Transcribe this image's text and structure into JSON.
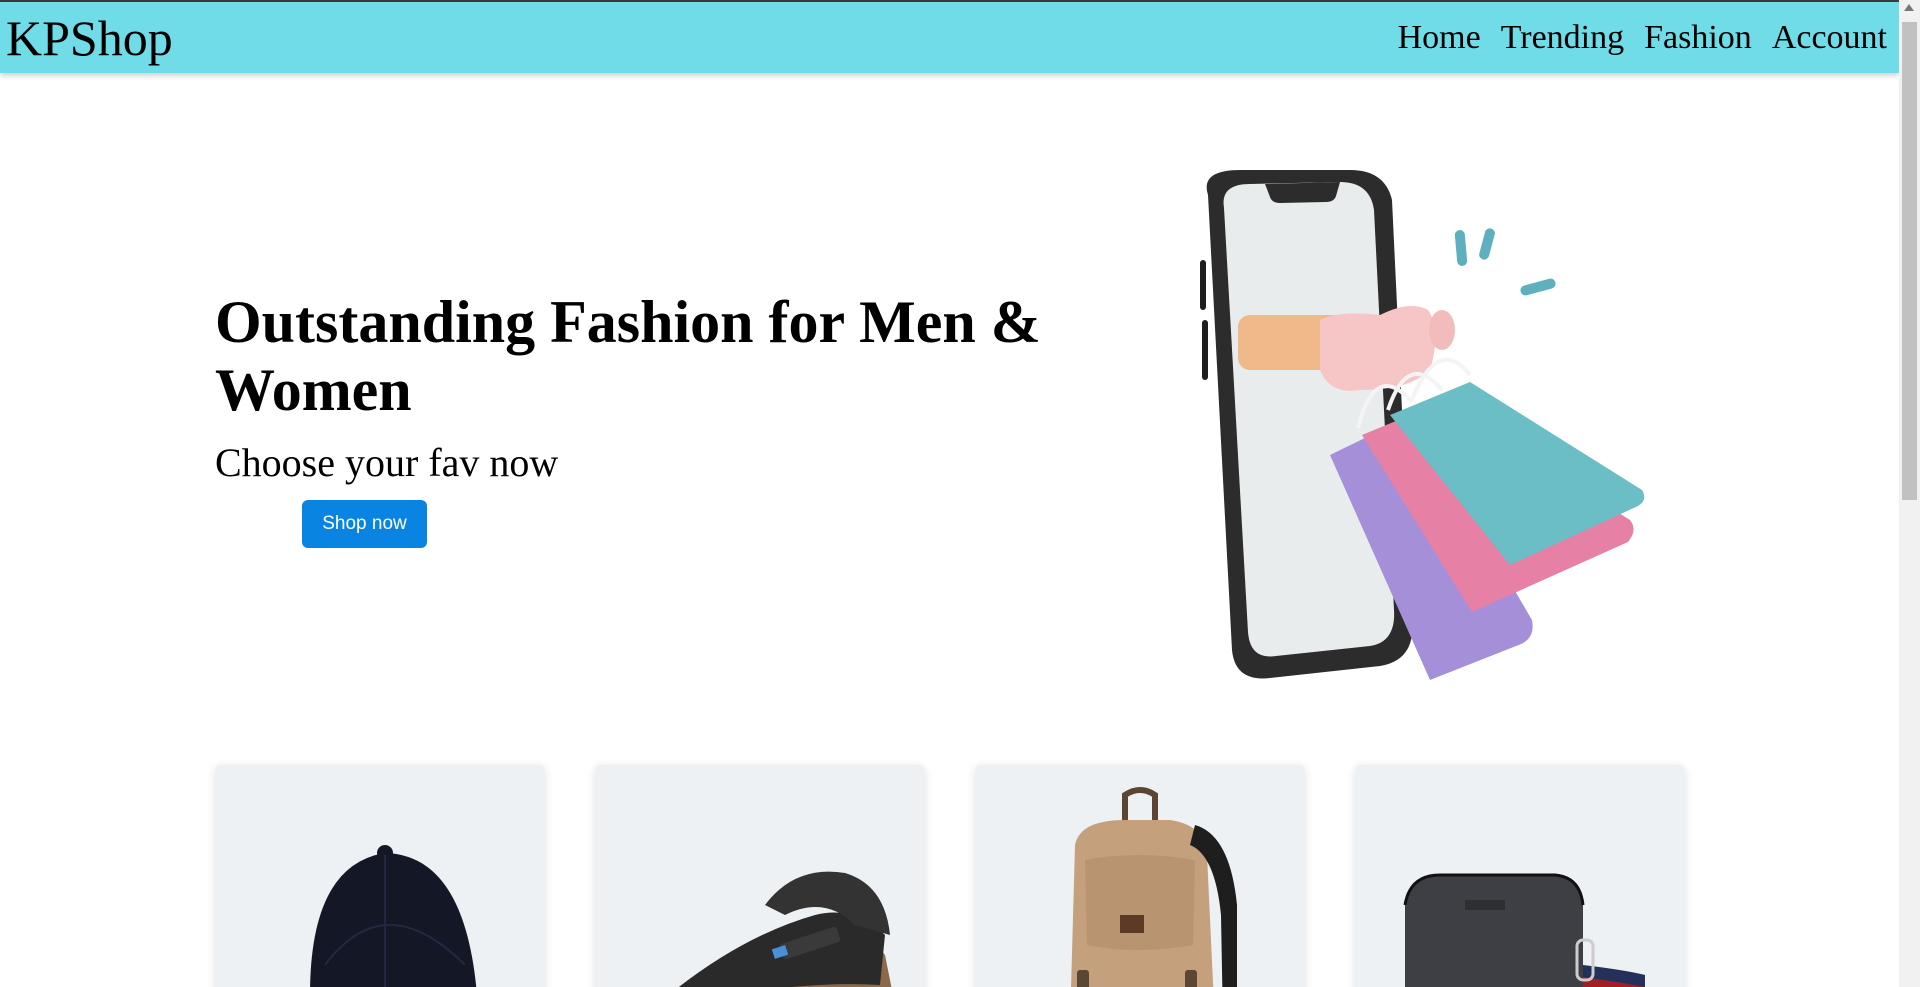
{
  "navbar": {
    "brand": "KPShop",
    "links": [
      "Home",
      "Trending",
      "Fashion",
      "Account"
    ],
    "background_color": "#6fdce8"
  },
  "hero": {
    "title": "Outstanding Fashion for Men & Women",
    "subtitle": "Choose your fav now",
    "button_label": "Shop now",
    "button_color": "#0a84e3",
    "illustration": "phone-with-shopping-bags-icon"
  },
  "products": [
    {
      "image": "cap-image"
    },
    {
      "image": "sandal-image"
    },
    {
      "image": "backpack-image"
    },
    {
      "image": "crossbody-bag-image"
    }
  ]
}
